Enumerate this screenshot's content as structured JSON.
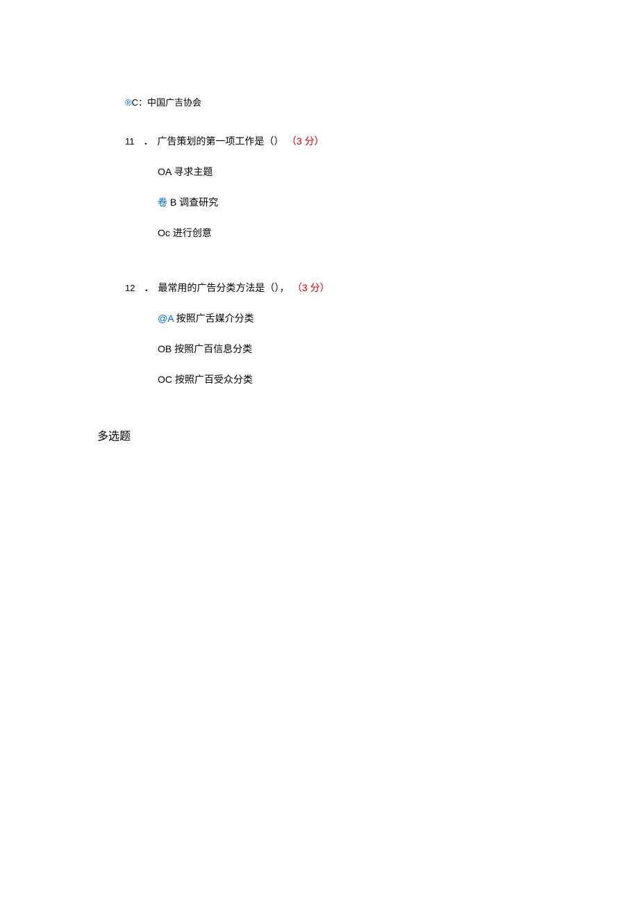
{
  "line1": {
    "mark": "®",
    "text": "C：中国广吉协会"
  },
  "q11": {
    "num": "11",
    "dot": "．",
    "text": "广告策划的第一项工作是（）",
    "score": "（3 分）",
    "optA": {
      "prefix": "OA",
      "text": " 寻求主题"
    },
    "optB": {
      "prefix": "卷 ",
      "letter": "B",
      "text": " 调查研究"
    },
    "optC": {
      "prefix": "Oc",
      "text": " 进行创意"
    }
  },
  "q12": {
    "num": "12",
    "dot": "．",
    "text": "最常用的广告分类方法是（），",
    "score": "（3 分）",
    "optA": {
      "prefix": "@A",
      "text": " 按照广舌媒介分类"
    },
    "optB": {
      "prefix": "OB",
      "text": " 按照广百信息分类"
    },
    "optC": {
      "prefix": "OC",
      "text": " 按照广百受众分类"
    }
  },
  "section": "多选题"
}
